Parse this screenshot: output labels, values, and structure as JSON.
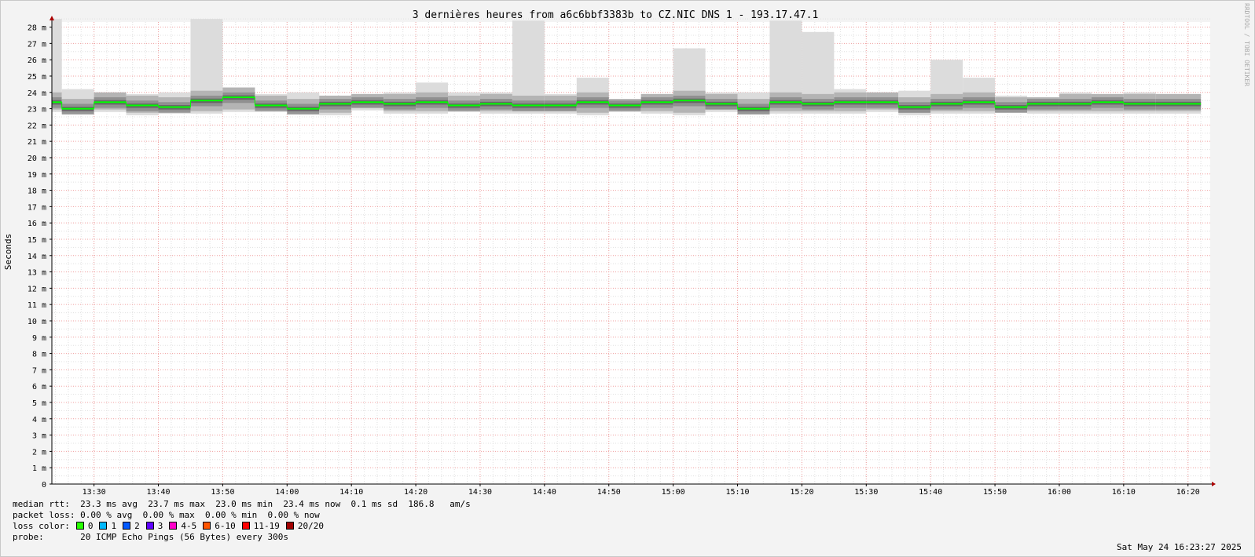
{
  "chart_data": {
    "type": "line",
    "title": "3 dernières heures from a6c6bbf3383b to CZ.NIC DNS 1 - 193.17.47.1",
    "ylabel": "Seconds",
    "xlabel": "",
    "ylim": [
      0,
      0.0287
    ],
    "y_ticks": [
      {
        "v": 0,
        "label": "0"
      },
      {
        "v": 0.001,
        "label": "1 m"
      },
      {
        "v": 0.002,
        "label": "2 m"
      },
      {
        "v": 0.003,
        "label": "3 m"
      },
      {
        "v": 0.004,
        "label": "4 m"
      },
      {
        "v": 0.005,
        "label": "5 m"
      },
      {
        "v": 0.006,
        "label": "6 m"
      },
      {
        "v": 0.007,
        "label": "7 m"
      },
      {
        "v": 0.008,
        "label": "8 m"
      },
      {
        "v": 0.009,
        "label": "9 m"
      },
      {
        "v": 0.01,
        "label": "10 m"
      },
      {
        "v": 0.011,
        "label": "11 m"
      },
      {
        "v": 0.012,
        "label": "12 m"
      },
      {
        "v": 0.013,
        "label": "13 m"
      },
      {
        "v": 0.014,
        "label": "14 m"
      },
      {
        "v": 0.015,
        "label": "15 m"
      },
      {
        "v": 0.016,
        "label": "16 m"
      },
      {
        "v": 0.017,
        "label": "17 m"
      },
      {
        "v": 0.018,
        "label": "18 m"
      },
      {
        "v": 0.019,
        "label": "19 m"
      },
      {
        "v": 0.02,
        "label": "20 m"
      },
      {
        "v": 0.021,
        "label": "21 m"
      },
      {
        "v": 0.022,
        "label": "22 m"
      },
      {
        "v": 0.023,
        "label": "23 m"
      },
      {
        "v": 0.024,
        "label": "24 m"
      },
      {
        "v": 0.025,
        "label": "25 m"
      },
      {
        "v": 0.026,
        "label": "26 m"
      },
      {
        "v": 0.027,
        "label": "27 m"
      },
      {
        "v": 0.028,
        "label": "28 m"
      }
    ],
    "x_ticks": [
      "13:30",
      "13:40",
      "13:50",
      "14:00",
      "14:10",
      "14:20",
      "14:30",
      "14:40",
      "14:50",
      "15:00",
      "15:10",
      "15:20",
      "15:30",
      "15:40",
      "15:50",
      "16:00",
      "16:10",
      "16:20"
    ],
    "x_range": [
      "13:23:27",
      "16:23:27"
    ],
    "grid": true,
    "series": [
      {
        "interval_start": [
          "13:23:27",
          "13:25",
          "13:30",
          "13:35",
          "13:40",
          "13:45",
          "13:50",
          "13:55",
          "14:00",
          "14:05",
          "14:10",
          "14:15",
          "14:20",
          "14:25",
          "14:30",
          "14:35",
          "14:40",
          "14:45",
          "14:50",
          "14:55",
          "15:00",
          "15:05",
          "15:10",
          "15:15",
          "15:20",
          "15:25",
          "15:30",
          "15:35",
          "15:40",
          "15:45",
          "15:50",
          "15:55",
          "16:00",
          "16:05",
          "16:10",
          "16:15"
        ],
        "median": [
          0.0234,
          0.023,
          0.0234,
          0.0232,
          0.0231,
          0.0235,
          0.0237,
          0.0232,
          0.023,
          0.0233,
          0.0234,
          0.0233,
          0.0234,
          0.0232,
          0.0233,
          0.0232,
          0.0232,
          0.0234,
          0.0232,
          0.0234,
          0.0235,
          0.0233,
          0.023,
          0.0234,
          0.0233,
          0.0234,
          0.0234,
          0.0231,
          0.0233,
          0.0234,
          0.0231,
          0.0233,
          0.0233,
          0.0234,
          0.0233,
          0.0233
        ],
        "min": [
          0.0228,
          0.0227,
          0.0228,
          0.0226,
          0.0227,
          0.0227,
          0.0228,
          0.0228,
          0.0227,
          0.0226,
          0.0229,
          0.0227,
          0.0227,
          0.0228,
          0.0227,
          0.0227,
          0.0227,
          0.0226,
          0.0228,
          0.0227,
          0.0226,
          0.0228,
          0.0227,
          0.0227,
          0.0227,
          0.0227,
          0.0228,
          0.0226,
          0.0227,
          0.0227,
          0.0228,
          0.0227,
          0.0227,
          0.0227,
          0.0227,
          0.0227
        ],
        "max": [
          0.0285,
          0.0242,
          0.024,
          0.0239,
          0.024,
          0.0285,
          0.0243,
          0.0239,
          0.024,
          0.0238,
          0.0239,
          0.024,
          0.0246,
          0.024,
          0.024,
          0.0284,
          0.0239,
          0.0249,
          0.0236,
          0.0239,
          0.0267,
          0.024,
          0.024,
          0.0284,
          0.0277,
          0.0242,
          0.024,
          0.0241,
          0.026,
          0.0249,
          0.0238,
          0.0237,
          0.024,
          0.0239,
          0.024,
          0.0239
        ],
        "loss_color": "0"
      }
    ],
    "colors": {
      "median_line": "#00ff00",
      "grid_minor": "#e0e0e0",
      "grid_major": "#f0a0a0",
      "smoke_light": "#dcdcdc",
      "smoke_dark": "#606060",
      "axis_arrow": "#aa0000"
    }
  },
  "stats": {
    "median_rtt_label": "median rtt:",
    "median_rtt": "23.3 ms avg  23.7 ms max  23.0 ms min  23.4 ms now  0.1 ms sd  186.8   am/s",
    "packet_loss_label": "packet loss:",
    "packet_loss": "0.00 % avg  0.00 % max  0.00 % min  0.00 % now",
    "loss_color_label": "loss color:",
    "loss_colors": [
      {
        "label": "0",
        "color": "#26ff00"
      },
      {
        "label": "1",
        "color": "#00b8ff"
      },
      {
        "label": "2",
        "color": "#0059ff"
      },
      {
        "label": "3",
        "color": "#5e00ff"
      },
      {
        "label": "4-5",
        "color": "#ff00c8"
      },
      {
        "label": "6-10",
        "color": "#ff5500"
      },
      {
        "label": "11-19",
        "color": "#ff0000"
      },
      {
        "label": "20/20",
        "color": "#a10000"
      }
    ],
    "probe_label": "probe:",
    "probe": "20 ICMP Echo Pings (56 Bytes) every 300s"
  },
  "timestamp": "Sat May 24 16:23:27 2025",
  "watermark": "RRDTOOL / TOBI OETIKER"
}
